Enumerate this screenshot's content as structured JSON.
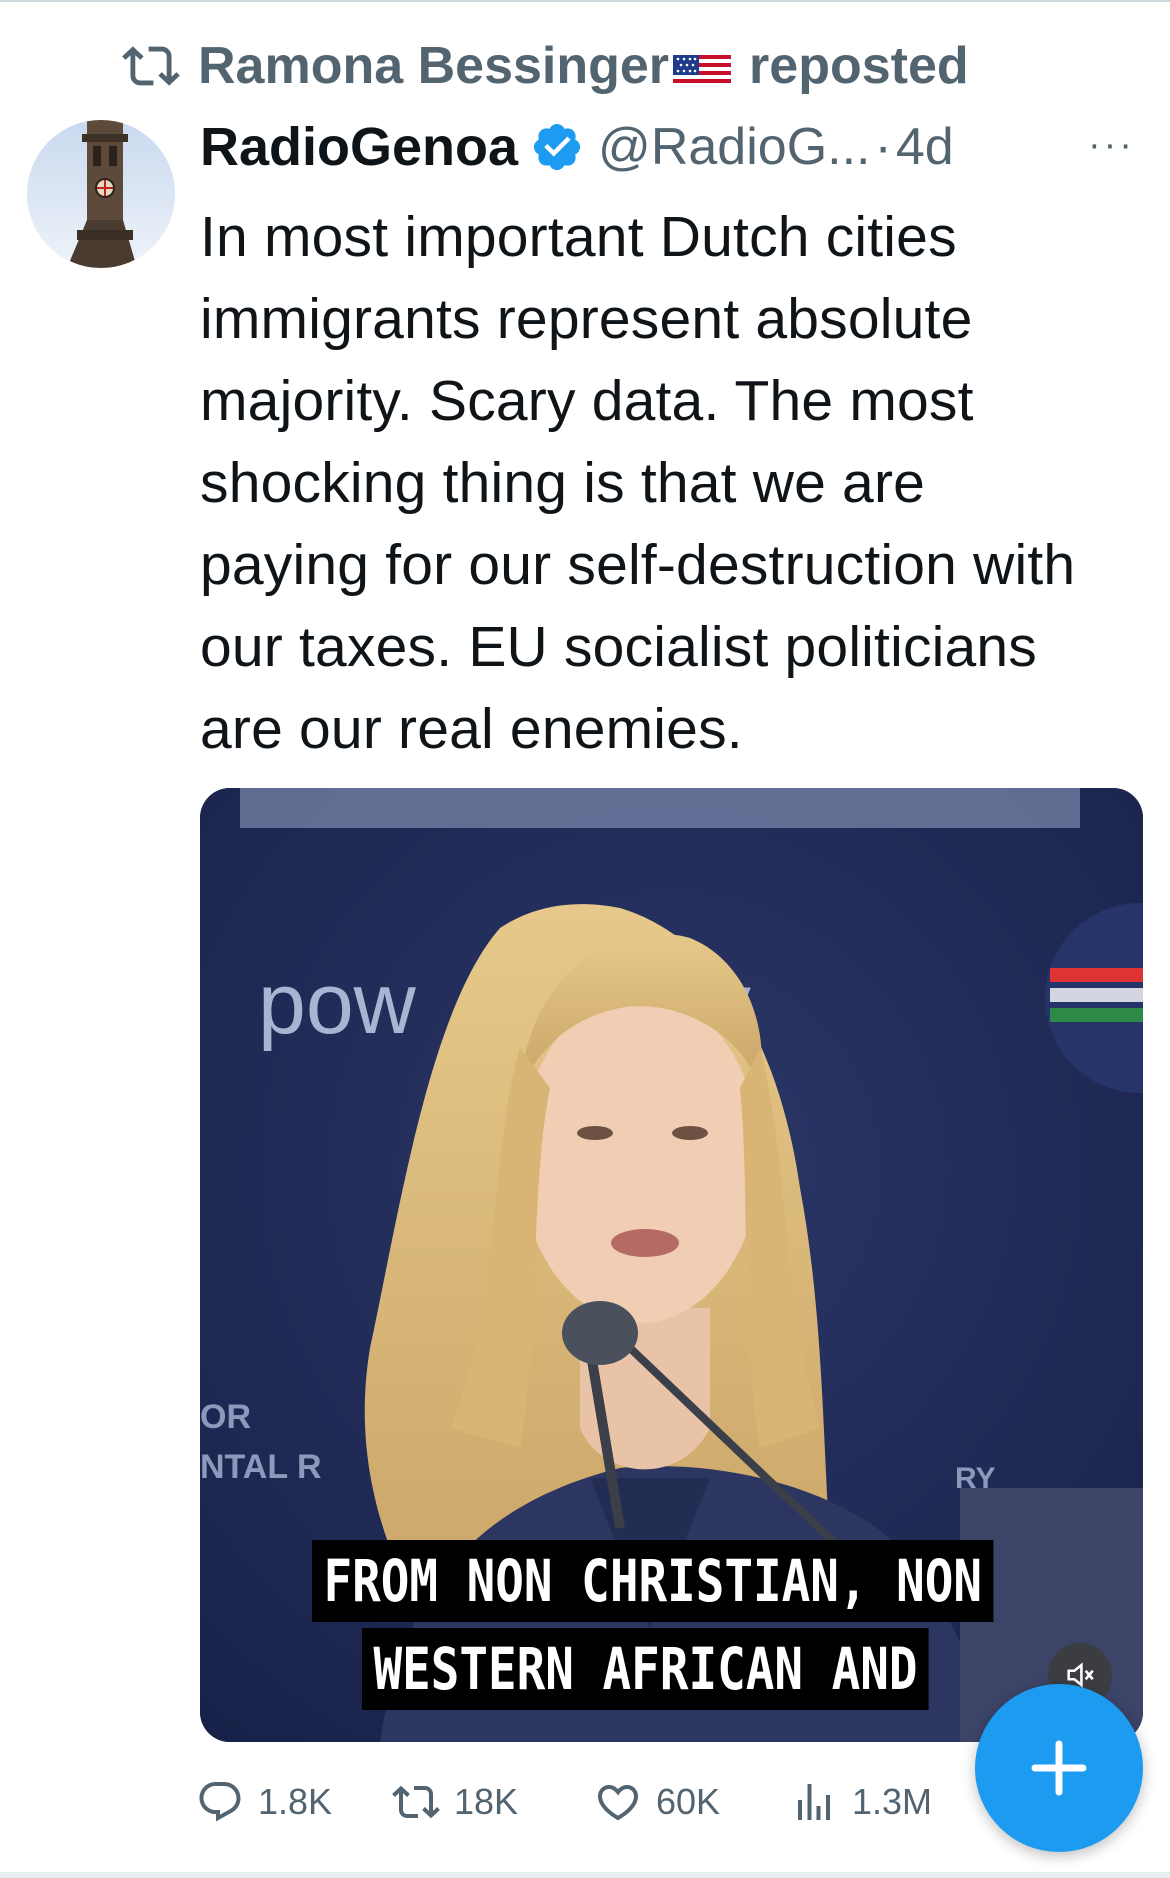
{
  "repost": {
    "user": "Ramona Bessinger",
    "label": "reposted"
  },
  "post": {
    "display_name": "RadioGenoa",
    "handle": "@RadioG...",
    "separator": "·",
    "time": "4d",
    "more_label": "···",
    "text": "In most important Dutch cities immigrants represent absolute majority. Scary data. The most shocking thing is that we are paying for our self-destruction with our taxes. EU socialist politicians are our real enemies."
  },
  "media": {
    "caption_line1": "FROM NON CHRISTIAN, NON",
    "caption_line2": "WESTERN AFRICAN AND",
    "backdrop_text_left": "pow",
    "backdrop_text_right": "oy",
    "backdrop_small_1": "OR",
    "backdrop_small_2": "NTAL R",
    "backdrop_small_3": "RY"
  },
  "actions": {
    "replies": "1.8K",
    "reposts": "18K",
    "likes": "60K",
    "views": "1.3M"
  },
  "colors": {
    "accent": "#1d9bf0",
    "secondary_text": "#536471",
    "primary_text": "#0f1419"
  },
  "icons": {
    "repost": "repost-icon",
    "verified": "verified-badge-icon",
    "reply": "reply-icon",
    "like": "heart-icon",
    "views": "views-chart-icon",
    "mute": "mute-icon",
    "compose": "plus-icon",
    "more": "more-icon"
  }
}
